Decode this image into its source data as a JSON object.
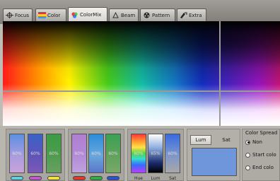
{
  "tabs": [
    {
      "label": "Focus",
      "icon": "crosshair-icon"
    },
    {
      "label": "Color",
      "icon": "color-bars-icon"
    },
    {
      "label": "ColorMix",
      "icon": "color-wheel-icon",
      "active": true
    },
    {
      "label": "Beam",
      "icon": "beam-icon"
    },
    {
      "label": "Pattern",
      "icon": "pattern-icon"
    },
    {
      "label": "Extra",
      "icon": "extra-icon"
    }
  ],
  "mixers": {
    "group1": [
      {
        "value": "60%"
      },
      {
        "value": "60%"
      },
      {
        "value": "60%"
      }
    ],
    "group2": [
      {
        "value": "60%"
      },
      {
        "value": "60%"
      },
      {
        "value": "60%"
      }
    ],
    "group3": [
      {
        "value": "60%",
        "label": "Hue"
      },
      {
        "value": "65%",
        "label": "Lum"
      },
      {
        "value": "60%",
        "label": "Sat"
      }
    ]
  },
  "lumsat": {
    "lum_label": "Lum",
    "sat_label": "Sat",
    "preview_color": "#6f96da"
  },
  "color_spread": {
    "title": "Color Spread",
    "options": [
      {
        "label": "Non",
        "checked": true
      },
      {
        "label": "Start colo",
        "checked": false
      },
      {
        "label": "End colo",
        "checked": false
      }
    ]
  }
}
